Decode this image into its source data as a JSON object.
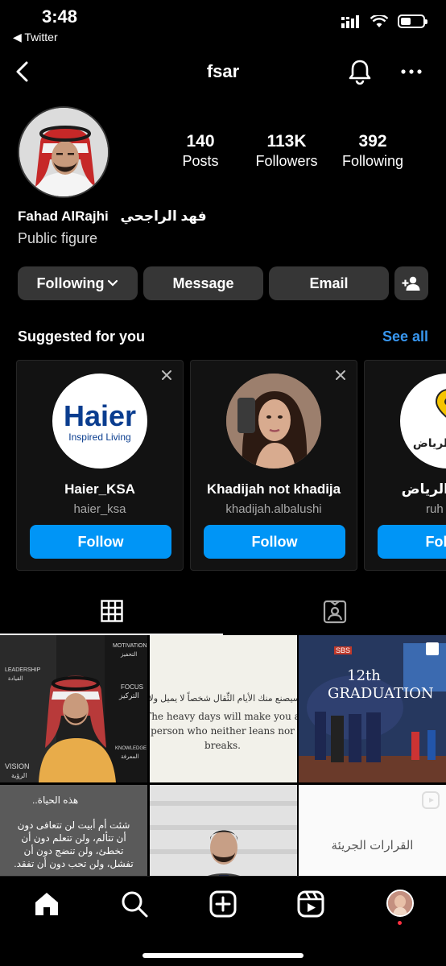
{
  "status_bar": {
    "time": "3:48",
    "back_app": "◀ Twitter"
  },
  "nav": {
    "username": "fsar",
    "icons": [
      "back-chevron-icon",
      "bell-icon",
      "more-dots-icon"
    ]
  },
  "profile": {
    "posts_count": "140",
    "posts_label": "Posts",
    "followers_count": "113K",
    "followers_label": "Followers",
    "following_count": "392",
    "following_label": "Following",
    "name": "Fahad AlRajhi",
    "name_arabic": "فهد الراجحي",
    "category": "Public figure"
  },
  "actions": {
    "following_label": "Following",
    "message_label": "Message",
    "email_label": "Email"
  },
  "suggested": {
    "title": "Suggested for you",
    "see_all": "See all",
    "cards": [
      {
        "name": "Haier_KSA",
        "username": "haier_ksa",
        "follow_label": "Follow",
        "logo_text": "Haier",
        "logo_tagline": "Inspired Living"
      },
      {
        "name": "Khadijah not khadija",
        "username": "khadijah.albalushi",
        "follow_label": "Follow"
      },
      {
        "name": "الرياض",
        "username": "ruh",
        "follow_label": "Follow",
        "logo_text": "الرياض"
      }
    ]
  },
  "tabs": [
    "grid-icon",
    "tagged-icon"
  ],
  "grid_posts": {
    "post1_words": [
      "MOTIVATION",
      "التحفيز",
      "FOCUS",
      "التركيز",
      "LEADERSHIP",
      "القيادة",
      "VISION",
      "الرؤية",
      "KNOWLEDGE",
      "المعرفة"
    ],
    "post2_ar": "سيصنع منك الأيام الثِّقال شخصاً لا يميل ولا ينكسر",
    "post2_en": "The heavy days will make you a person who neither leans nor breaks.",
    "post3_text": "12th GRADUATION",
    "post3_badge": "SBS",
    "post4_title": "هذه الحياة..",
    "post4_body": "شئت أم أبيت لن تتعافى دون أن تتألم، ولن تتعلم دون أن تخطئ، ولن تنضج دون أن تفشل، ولن تحب دون أن تفقد.",
    "post6_text": "القرارات الجريئة"
  },
  "colors": {
    "background": "#000000",
    "button_gray": "#363636",
    "accent_blue": "#0095f6",
    "link_blue": "#3897f0",
    "notification_dot": "#ff3040"
  },
  "bottom_nav": [
    "home-icon",
    "search-icon",
    "new-post-icon",
    "reels-icon",
    "profile-avatar"
  ]
}
